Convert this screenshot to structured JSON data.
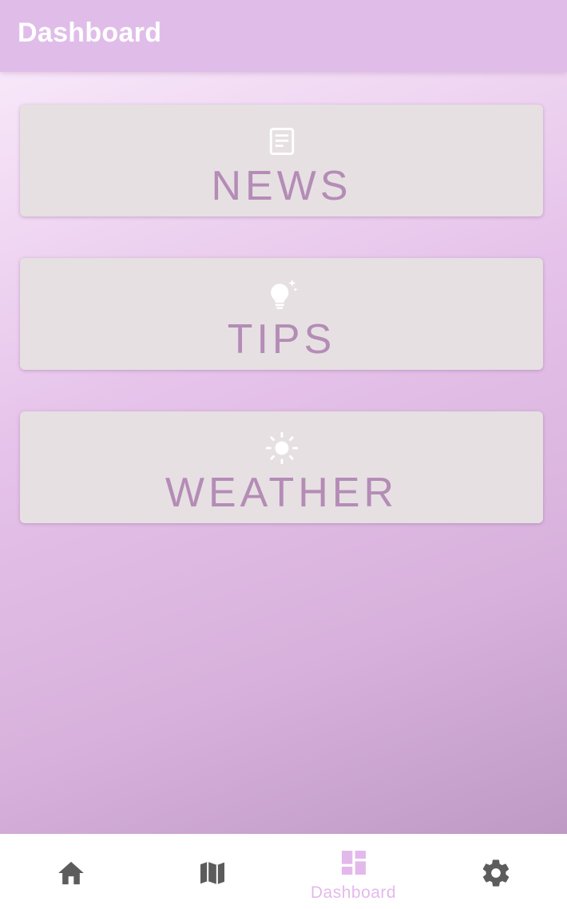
{
  "appbar": {
    "title": "Dashboard"
  },
  "cards": [
    {
      "label": "NEWS",
      "icon": "article-icon"
    },
    {
      "label": "TIPS",
      "icon": "lightbulb-sparkle-icon"
    },
    {
      "label": "WEATHER",
      "icon": "sun-icon"
    }
  ],
  "bottom_nav": {
    "items": [
      {
        "icon": "home-icon",
        "label": ""
      },
      {
        "icon": "map-icon",
        "label": ""
      },
      {
        "icon": "dashboard-icon",
        "label": "Dashboard",
        "active": true
      },
      {
        "icon": "gear-icon",
        "label": ""
      }
    ]
  },
  "colors": {
    "appbar": "#e0bde8",
    "card_background": "#e6e0e2",
    "card_label": "#b48cb6",
    "card_icon": "#ffffff",
    "nav_active": "#e3b9ec",
    "nav_inactive": "#5c5c5c"
  }
}
